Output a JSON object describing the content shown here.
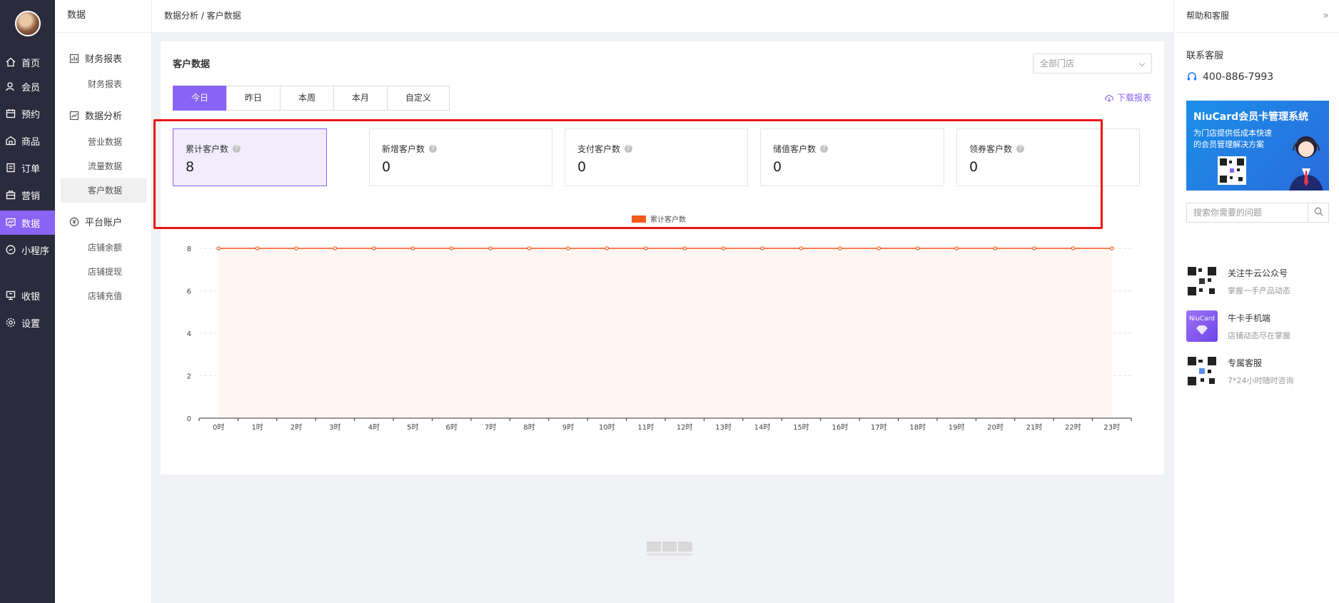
{
  "nav": {
    "items": [
      {
        "label": "首页",
        "icon": "home-icon"
      },
      {
        "label": "会员",
        "icon": "members-icon"
      },
      {
        "label": "预约",
        "icon": "calendar-icon"
      },
      {
        "label": "商品",
        "icon": "goods-icon"
      },
      {
        "label": "订单",
        "icon": "order-icon"
      },
      {
        "label": "营销",
        "icon": "marketing-icon"
      },
      {
        "label": "数据",
        "icon": "data-icon",
        "active": true
      },
      {
        "label": "小程序",
        "icon": "miniprogram-icon"
      },
      {
        "label": "收银",
        "icon": "cashier-icon"
      },
      {
        "label": "设置",
        "icon": "settings-icon"
      }
    ]
  },
  "subnav": {
    "title": "数据",
    "groups": [
      {
        "label": "财务报表",
        "icon": "report-icon",
        "links": [
          "财务报表"
        ]
      },
      {
        "label": "数据分析",
        "icon": "analysis-icon",
        "links": [
          "营业数据",
          "流量数据",
          "客户数据"
        ]
      },
      {
        "label": "平台账户",
        "icon": "account-icon",
        "links": [
          "店铺余额",
          "店铺提现",
          "店铺充值"
        ]
      }
    ],
    "active_link": "客户数据"
  },
  "breadcrumb": "数据分析 / 客户数据",
  "card": {
    "title": "客户数据",
    "store_select": "全部门店",
    "tabs": [
      "今日",
      "昨日",
      "本周",
      "本月",
      "自定义"
    ],
    "active_tab": "今日",
    "download_label": "下载报表",
    "stats": [
      {
        "label": "累计客户数",
        "value": "8",
        "active": true
      },
      {
        "label": "新增客户数",
        "value": "0"
      },
      {
        "label": "支付客户数",
        "value": "0"
      },
      {
        "label": "储值客户数",
        "value": "0"
      },
      {
        "label": "领券客户数",
        "value": "0"
      }
    ]
  },
  "chart_data": {
    "type": "area",
    "legend": [
      "累计客户数"
    ],
    "legend_position": "top-center",
    "x": [
      "0时",
      "1时",
      "2时",
      "3时",
      "4时",
      "5时",
      "6时",
      "7时",
      "8时",
      "9时",
      "10时",
      "11时",
      "12时",
      "13时",
      "14时",
      "15时",
      "16时",
      "17时",
      "18时",
      "19时",
      "20时",
      "21时",
      "22时",
      "23时"
    ],
    "series": [
      {
        "name": "累计客户数",
        "values": [
          8,
          8,
          8,
          8,
          8,
          8,
          8,
          8,
          8,
          8,
          8,
          8,
          8,
          8,
          8,
          8,
          8,
          8,
          8,
          8,
          8,
          8,
          8,
          8
        ],
        "color": "#f65a1a"
      }
    ],
    "yticks": [
      0,
      2,
      4,
      6,
      8
    ],
    "ylim": [
      0,
      8
    ],
    "grid": true
  },
  "right": {
    "title": "帮助和客服",
    "contact_title": "联系客服",
    "phone": "400-886-7993",
    "banner": {
      "title": "NiuCard会员卡管理系统",
      "subtitle": "为门店提供低成本快速的会员管理解决方案"
    },
    "search_placeholder": "搜索你需要的问题",
    "services": [
      {
        "title": "关注牛云公众号",
        "desc": "掌握一手产品动态",
        "icon": "qrcode-icon"
      },
      {
        "title": "牛卡手机端",
        "desc": "店铺动态尽在掌握",
        "icon": "niucard-app-icon",
        "brand": "NiuCard"
      },
      {
        "title": "专属客服",
        "desc": "7*24小时随时咨询",
        "icon": "qrcode-icon"
      }
    ]
  },
  "colors": {
    "accent": "#8963f3",
    "nav_bg": "#2b2b3d",
    "series": "#f65a1a",
    "highlight_box": "#e81717"
  }
}
